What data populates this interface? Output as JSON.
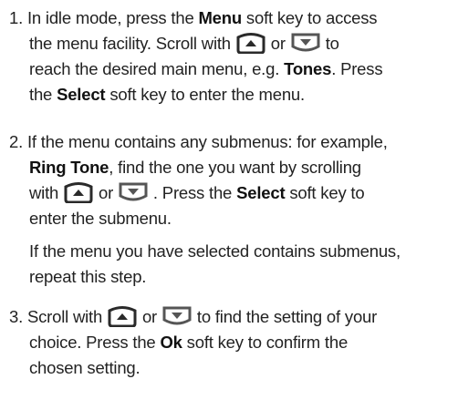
{
  "steps": {
    "s1": {
      "l1a": "1.  In idle mode, press the ",
      "l1b": "Menu",
      "l1c": " soft key to access",
      "l2a": "the menu facility. Scroll with ",
      "l2b": " or ",
      "l2c": " to",
      "l3a": "reach the desired main menu, e.g. ",
      "l3b": "Tones",
      "l3c": ". Press",
      "l4a": "the ",
      "l4b": "Select",
      "l4c": " soft key to enter the menu."
    },
    "s2": {
      "l1": "2.  If the menu contains any submenus: for example,",
      "l2a": "Ring Tone",
      "l2b": ", find the one you want by scrolling",
      "l3a": "with ",
      "l3b": " or ",
      "l3c": " . Press the ",
      "l3d": "Select",
      "l3e": " soft key to",
      "l4": "enter the submenu."
    },
    "note": {
      "l1": "If the menu you have selected contains submenus,",
      "l2": "repeat this step."
    },
    "s3": {
      "l1a": "3.  Scroll with ",
      "l1b": " or ",
      "l1c": " to find the setting of your",
      "l2a": "choice. Press the ",
      "l2b": "Ok",
      "l2c": " soft key to confirm the",
      "l3": "chosen setting."
    }
  },
  "icons": {
    "up": "scroll-up-key-icon",
    "down": "scroll-down-key-icon"
  },
  "colors": {
    "up_key": "#2a2a2a",
    "down_key": "#555555"
  }
}
